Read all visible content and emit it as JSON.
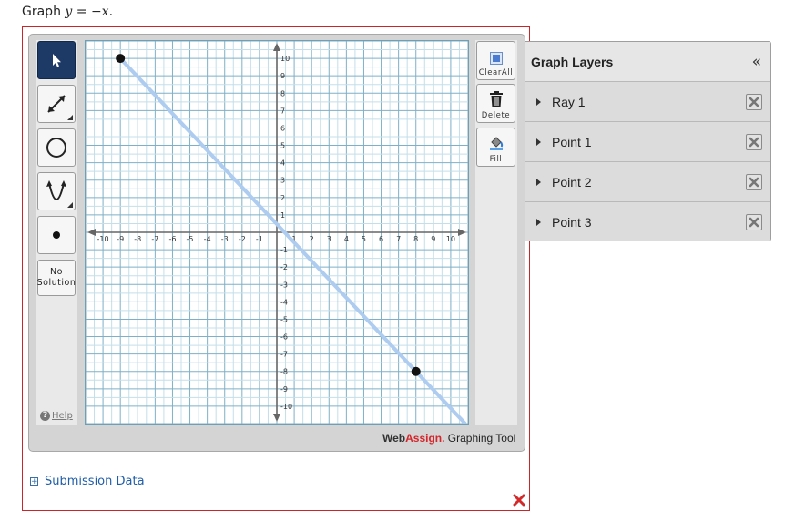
{
  "question": {
    "prefix": "Graph ",
    "equation": "y = −x",
    "suffix": "."
  },
  "tools": {
    "no_solution_line1": "No",
    "no_solution_line2": "Solution",
    "help": "Help"
  },
  "actions": {
    "clear_all": "ClearAll",
    "delete": "Delete",
    "fill": "Fill"
  },
  "brand": {
    "web": "Web",
    "assign": "Assign.",
    "rest": " Graphing Tool"
  },
  "layers": {
    "title": "Graph Layers",
    "collapse": "«",
    "items": [
      {
        "label": "Ray 1"
      },
      {
        "label": "Point 1"
      },
      {
        "label": "Point 2"
      },
      {
        "label": "Point 3"
      }
    ]
  },
  "submission": {
    "label": "Submission Data",
    "expand": "+"
  },
  "graph": {
    "x_ticks": [
      "-10",
      "-9",
      "-8",
      "-7",
      "-6",
      "-5",
      "-4",
      "-3",
      "-2",
      "-1",
      "1",
      "2",
      "3",
      "4",
      "5",
      "6",
      "7",
      "8",
      "9",
      "10"
    ],
    "y_ticks": [
      "10",
      "9",
      "8",
      "7",
      "6",
      "5",
      "4",
      "3",
      "2",
      "1",
      "-1",
      "-2",
      "-3",
      "-4",
      "-5",
      "-6",
      "-7",
      "-8",
      "-9",
      "-10"
    ],
    "xlim": [
      -11,
      11
    ],
    "ylim": [
      -11,
      11
    ],
    "ray": {
      "start": [
        -9,
        10
      ],
      "through": [
        8,
        -8
      ],
      "color": "#aecbf0"
    },
    "points": [
      {
        "x": -9,
        "y": 10
      },
      {
        "x": 8,
        "y": -8
      }
    ]
  }
}
